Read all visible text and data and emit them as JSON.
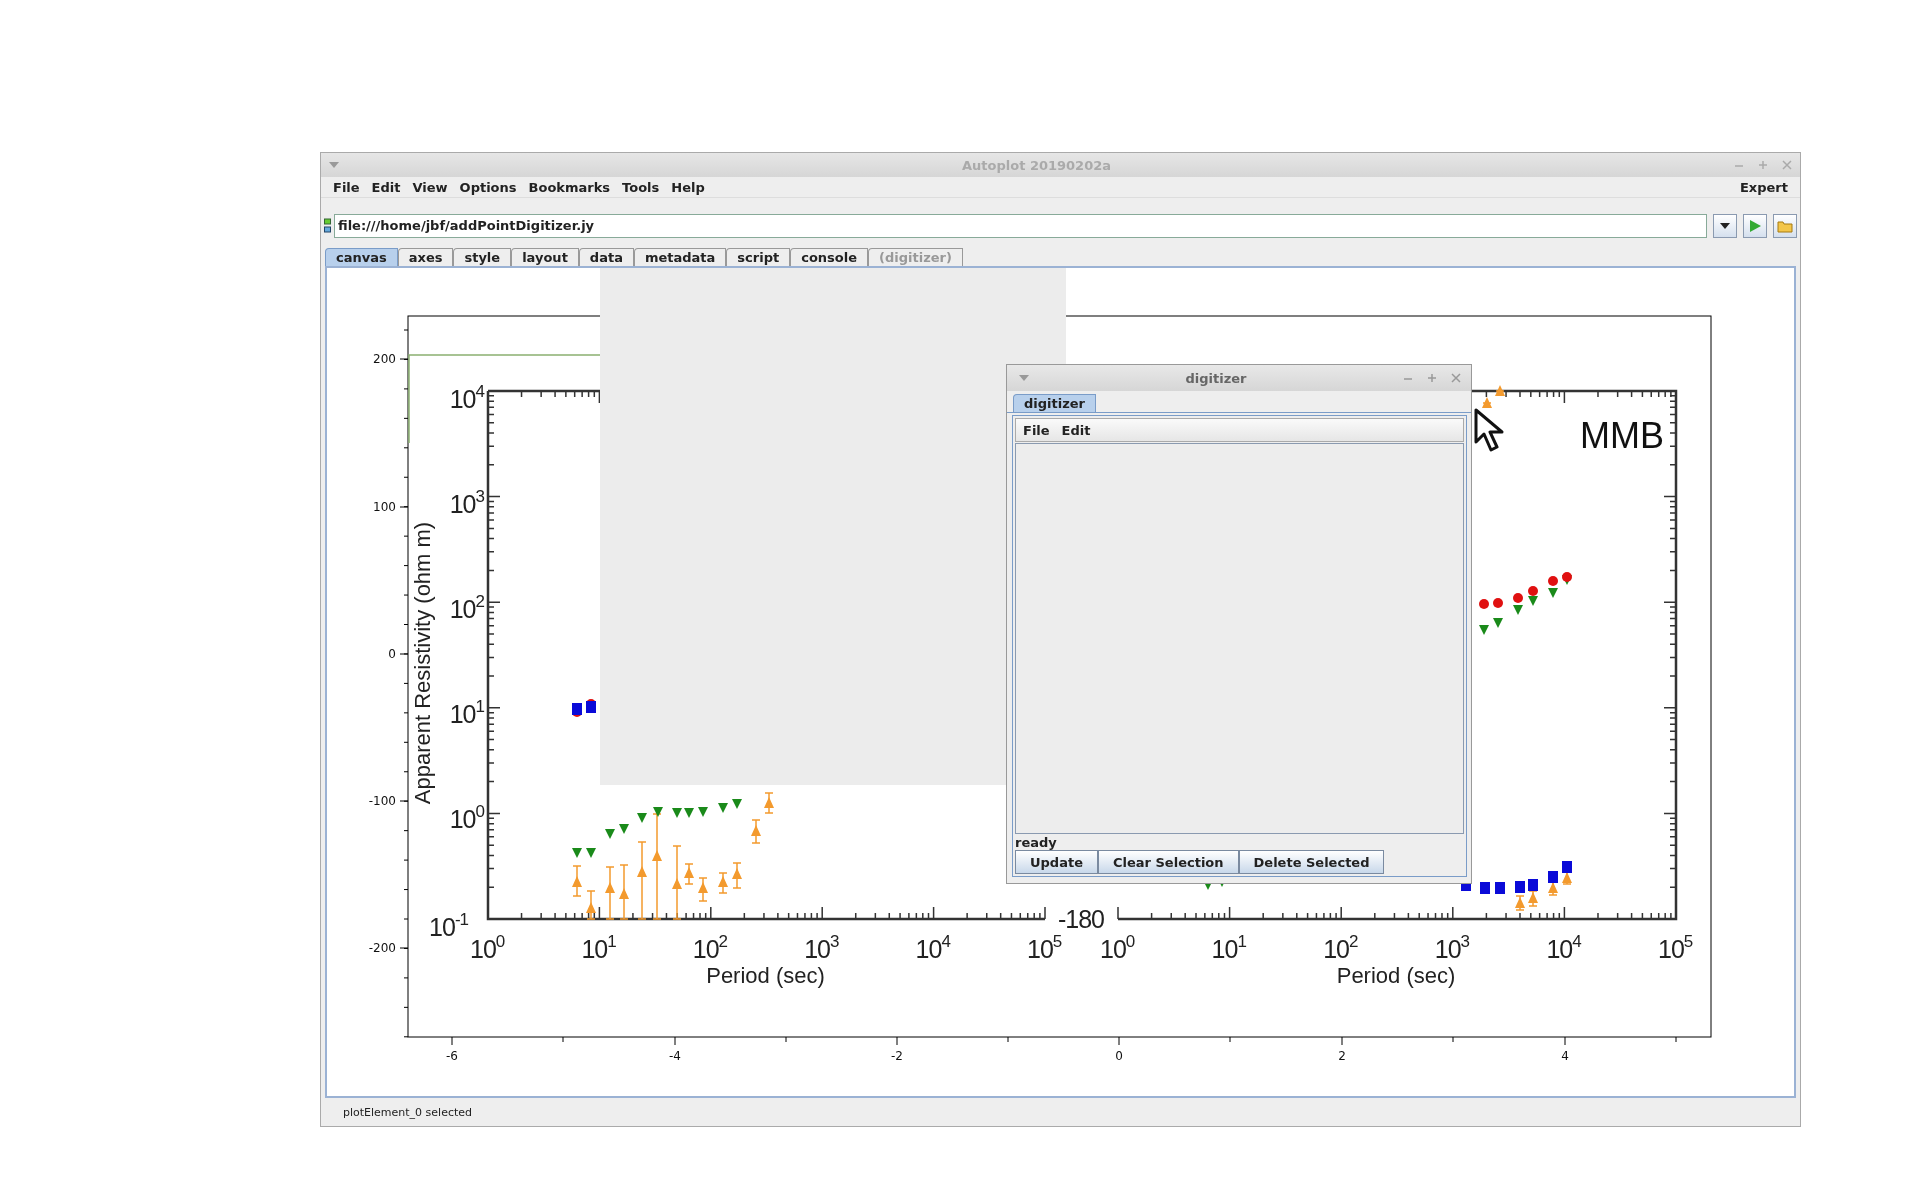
{
  "window": {
    "title": "Autoplot 20190202a"
  },
  "menu": [
    "File",
    "Edit",
    "View",
    "Options",
    "Bookmarks",
    "Tools",
    "Help"
  ],
  "mode_label": "Expert",
  "address": {
    "value": "file:///home/jbf/addPointDigitizer.jy"
  },
  "tabs": [
    {
      "label": "canvas",
      "selected": true,
      "disabled": false
    },
    {
      "label": "axes",
      "selected": false,
      "disabled": false
    },
    {
      "label": "style",
      "selected": false,
      "disabled": false
    },
    {
      "label": "layout",
      "selected": false,
      "disabled": false
    },
    {
      "label": "data",
      "selected": false,
      "disabled": false
    },
    {
      "label": "metadata",
      "selected": false,
      "disabled": false
    },
    {
      "label": "script",
      "selected": false,
      "disabled": false
    },
    {
      "label": "console",
      "selected": false,
      "disabled": false
    },
    {
      "label": "(digitizer)",
      "selected": false,
      "disabled": true
    }
  ],
  "plot": {
    "y_ticks": [
      "200",
      "100",
      "0",
      "-100",
      "-200"
    ],
    "x_ticks": [
      "-6",
      "-4",
      "-2",
      "0",
      "2",
      "4"
    ],
    "figure_image": {
      "panels": [
        {
          "x_ticks": [
            {
              "base": "10",
              "exp": "0"
            },
            {
              "base": "10",
              "exp": "1"
            },
            {
              "base": "10",
              "exp": "2"
            },
            {
              "base": "10",
              "exp": "3"
            },
            {
              "base": "10",
              "exp": "4"
            },
            {
              "base": "10",
              "exp": "5"
            }
          ],
          "y_ticks": [
            {
              "base": "10",
              "exp": "4"
            },
            {
              "base": "10",
              "exp": "3"
            },
            {
              "base": "10",
              "exp": "2"
            },
            {
              "base": "10",
              "exp": "1"
            },
            {
              "base": "10",
              "exp": "0"
            },
            {
              "base": "10",
              "exp": "-1"
            }
          ],
          "x_label": "Period (sec)",
          "y_label": "Apparent Resistivity (ohm m)"
        },
        {
          "x_ticks": [
            {
              "base": "10",
              "exp": "0"
            },
            {
              "base": "10",
              "exp": "1"
            },
            {
              "base": "10",
              "exp": "2"
            },
            {
              "base": "10",
              "exp": "3"
            },
            {
              "base": "10",
              "exp": "4"
            },
            {
              "base": "10",
              "exp": "5"
            }
          ],
          "y_ticks": [
            {
              "base": "-180"
            }
          ],
          "x_label": "Period (sec)",
          "title": "MMB"
        }
      ]
    }
  },
  "status_bar": "plotElement_0 selected",
  "digitizer": {
    "title": "digitizer",
    "tab": {
      "label": "digitizer",
      "selected": true
    },
    "menu": [
      "File",
      "Edit"
    ],
    "status": "ready",
    "buttons": [
      "Update",
      "Clear Selection",
      "Delete Selected"
    ]
  }
}
